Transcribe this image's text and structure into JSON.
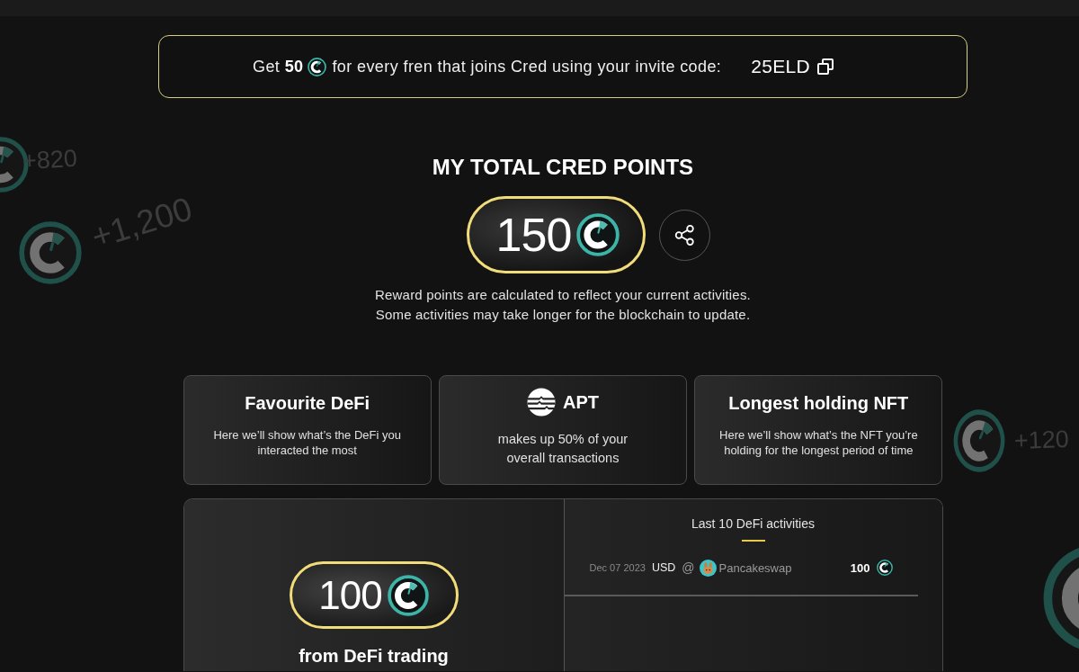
{
  "invite": {
    "lead": "Get **50**",
    "message": "for every fren that joins Cred using your invite code:",
    "code": "25ELD"
  },
  "points": {
    "title": "MY TOTAL CRED POINTS",
    "total": "150",
    "notes": [
      "Reward points are calculated to reflect your current activities.",
      "Some activities may take longer for the blockchain to update."
    ]
  },
  "stat_cards": [
    {
      "kind": "text",
      "title": "Favourite DeFi",
      "description": "Here we’ll show what’s the DeFi you interacted the most"
    },
    {
      "kind": "token",
      "title": "APT",
      "description": "makes up 50% of your overall transactions"
    },
    {
      "kind": "text",
      "title": "Longest holding NFT",
      "description": "Here we’ll show what’s the NFT you’re holding for the longest period of time"
    }
  ],
  "defi": {
    "points": "100",
    "caption": "from DeFi trading",
    "activities_title": "Last 10 DeFi activities",
    "activities": [
      {
        "date": "Dec 07 2023",
        "token": "USD",
        "separator": "@",
        "platform": "Pancakeswap",
        "points": "100"
      }
    ]
  },
  "bonus_badges": [
    {
      "amount": "+820"
    },
    {
      "amount": "+1,200"
    },
    {
      "amount": "+120"
    }
  ]
}
